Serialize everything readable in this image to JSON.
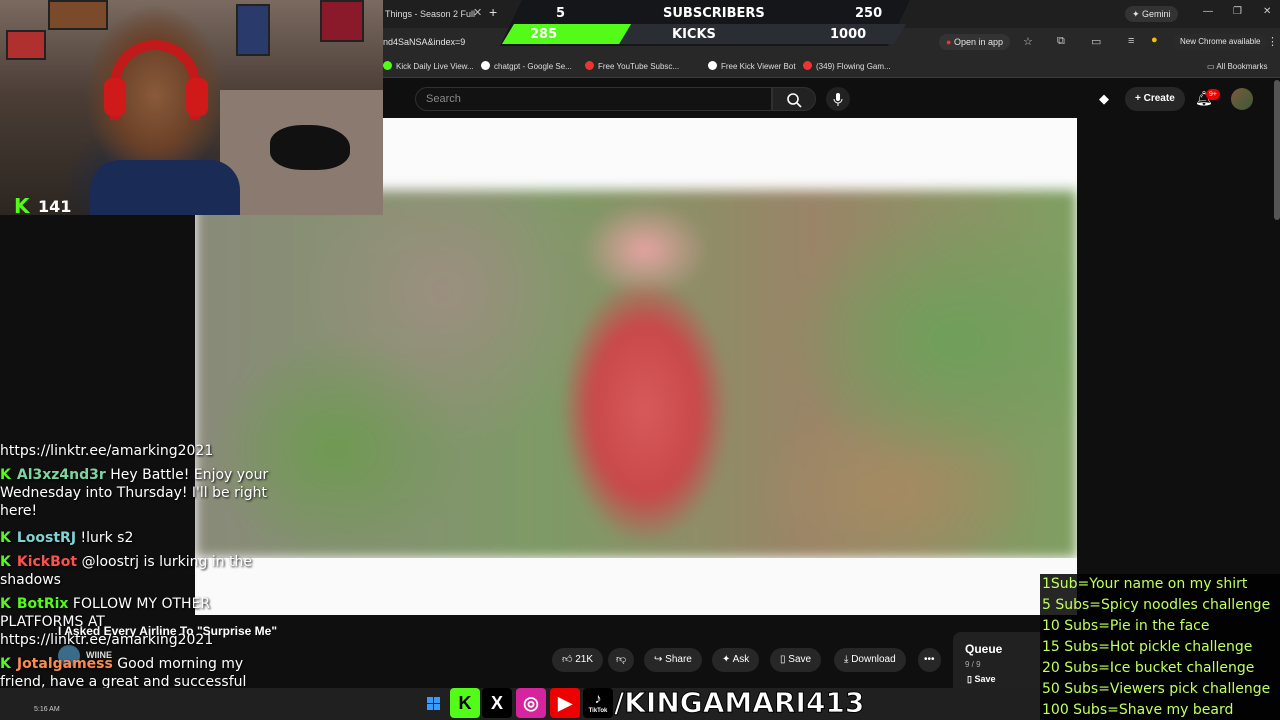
{
  "browser": {
    "tab_title": "Things - Season 2 Full",
    "url": "nd4SaNSA&index=9",
    "gemini": "Gemini",
    "open_in_app": "Open in app",
    "new_chrome": "New Chrome available",
    "all_bookmarks": "All Bookmarks",
    "bookmarks": [
      "Kick Daily Live View...",
      "chatgpt - Google Se...",
      "Free YouTube Subsc...",
      "Free Kick Viewer Bot",
      "(349) Flowing Gam..."
    ]
  },
  "goals": {
    "sub_current": "5",
    "sub_label": "SUBSCRIBERS",
    "sub_target": "250",
    "kick_current": "285",
    "kick_label": "KICKS",
    "kick_target": "1000",
    "kick_progress": 0.285,
    "accent": "#53fc18"
  },
  "youtube": {
    "search_placeholder": "Search",
    "create": "Create",
    "notif_badge": "9+",
    "video_title": "I Asked Every Airline To \"Surprise Me\"",
    "channel": "WIINE",
    "likes": "21K",
    "share": "Share",
    "ask": "Ask",
    "save": "Save",
    "download": "Download",
    "queue_title": "Queue",
    "queue_count": "9 / 9",
    "queue_save": "Save"
  },
  "webcam": {
    "kick_logo": "K",
    "viewer_count": "141"
  },
  "chat": [
    {
      "user": "",
      "text": "https://linktr.ee/amarking2021"
    },
    {
      "user": "Al3xz4nd3r",
      "text": "Hey Battle! Enjoy your Wednesday into Thursday! I'll be right here!"
    },
    {
      "user": "LoostRJ",
      "text": "!lurk s2"
    },
    {
      "user": "KickBot",
      "text": "@loostrj is lurking in the shadows"
    },
    {
      "user": "BotRix",
      "text": "FOLLOW MY OTHER PLATFORMS AT https://linktr.ee/amarking2021"
    },
    {
      "user": "Jotalgamess",
      "text": "Good morning my friend, have a great and successful live! I'm here supporting you."
    }
  ],
  "sub_goals": [
    "1Sub=Your name on my shirt",
    "5 Subs=Spicy noodles challenge",
    "10 Subs=Pie in the face",
    "15 Subs=Hot pickle challenge",
    "20 Subs=Ice bucket challenge",
    "50 Subs=Viewers pick challenge",
    "100 Subs=Shave my beard"
  ],
  "bottom": {
    "handle": "/KINGAMARI413",
    "tiktok_label": "TikTok",
    "clock": "5:16 AM"
  }
}
